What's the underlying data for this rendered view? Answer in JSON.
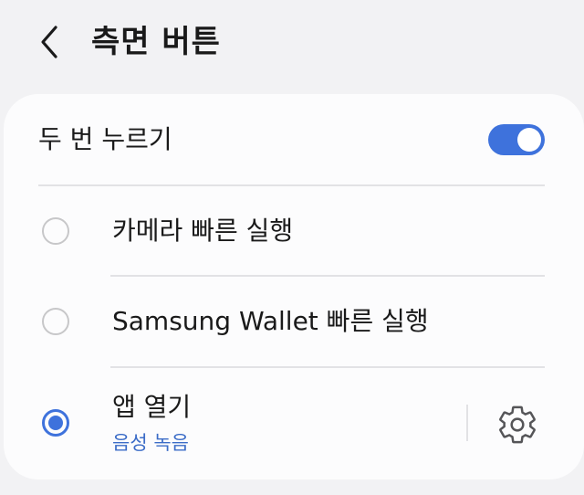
{
  "header": {
    "title": "측면 버튼",
    "back_icon": "chevron-left-icon"
  },
  "double_press": {
    "label": "두 번 누르기",
    "enabled": true,
    "accent_color": "#3e72dc"
  },
  "options": [
    {
      "label": "카메라 빠른 실행",
      "selected": false
    },
    {
      "label": "Samsung Wallet 빠른 실행",
      "selected": false
    },
    {
      "label": "앱 열기",
      "sublabel": "음성 녹음",
      "selected": true,
      "settings_icon": "gear-icon"
    }
  ]
}
